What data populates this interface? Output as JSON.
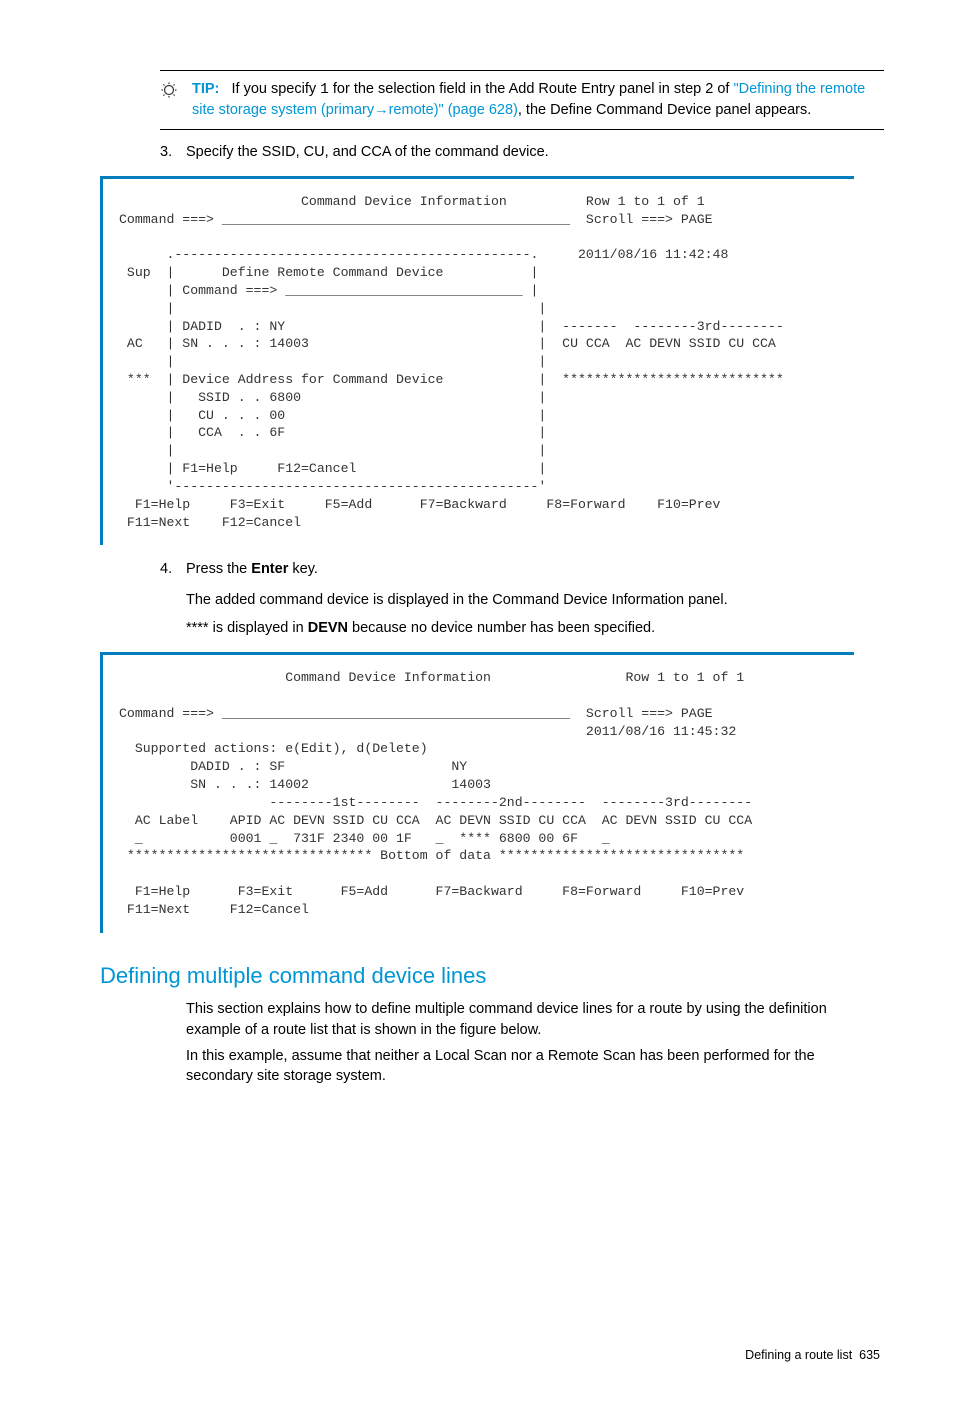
{
  "tip": {
    "label": "TIP:",
    "text_before": "If you specify ",
    "code": "1",
    "text_mid": " for the selection field in the Add Route Entry panel in step 2 of ",
    "link": "\"Defining the remote site storage system (primary→remote)\" (page 628)",
    "text_after": ", the Define Command Device panel appears."
  },
  "step3": {
    "num": "3.",
    "text": "Specify the SSID, CU, and CCA of the command device."
  },
  "screen1": "                       Command Device Information          Row 1 to 1 of 1\nCommand ===> ____________________________________________  Scroll ===> PAGE\n\n      .---------------------------------------------.     2011/08/16 11:42:48\n Sup  |      Define Remote Command Device           |\n      | Command ===> ______________________________ |\n      |                                              |\n      | DADID  . : NY                                |  -------  --------3rd--------\n AC   | SN . . . : 14003                             |  CU CCA  AC DEVN SSID CU CCA\n      |                                              |\n ***  | Device Address for Command Device            |  ****************************\n      |   SSID . . 6800                              |\n      |   CU . . . 00                                |\n      |   CCA  . . 6F                                |\n      |                                              |\n      | F1=Help     F12=Cancel                       |\n      '----------------------------------------------'\n  F1=Help     F3=Exit     F5=Add      F7=Backward     F8=Forward    F10=Prev\n F11=Next    F12=Cancel",
  "step4": {
    "num": "4.",
    "line1_before": "Press the ",
    "line1_bold": "Enter",
    "line1_after": " key.",
    "line2": "The added command device is displayed in the Command Device Information panel.",
    "line3_before": "**** is displayed in ",
    "line3_bold": "DEVN",
    "line3_after": " because no device number has been specified."
  },
  "screen2": "                     Command Device Information                 Row 1 to 1 of 1\n\nCommand ===> ____________________________________________  Scroll ===> PAGE\n                                                           2011/08/16 11:45:32\n  Supported actions: e(Edit), d(Delete)\n         DADID . : SF                     NY\n         SN . . .: 14002                  14003\n                   --------1st--------  --------2nd--------  --------3rd--------\n  AC Label    APID AC DEVN SSID CU CCA  AC DEVN SSID CU CCA  AC DEVN SSID CU CCA\n  _           0001 _  731F 2340 00 1F   _  **** 6800 00 6F   _\n ******************************* Bottom of data *******************************\n\n  F1=Help      F3=Exit      F5=Add      F7=Backward     F8=Forward     F10=Prev\n F11=Next     F12=Cancel",
  "section": {
    "title": "Defining multiple command device lines",
    "p1": "This section explains how to define multiple command device lines for a route by using the definition example of a route list that is shown in the figure below.",
    "p2": "In this example, assume that neither a Local Scan nor a Remote Scan has been performed for the secondary site storage system."
  },
  "footer": {
    "text": "Defining a route list",
    "page": "635"
  }
}
